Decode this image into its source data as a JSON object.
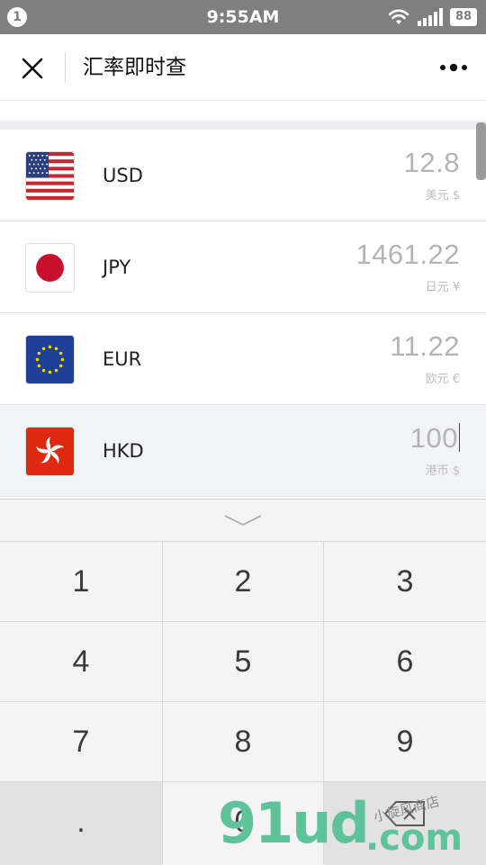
{
  "status_bar": {
    "notification_count": "1",
    "time": "9:55AM",
    "battery": "88"
  },
  "nav": {
    "title": "汇率即时查"
  },
  "currencies": [
    {
      "code": "USD",
      "amount": "12.8",
      "unit": "美元 $",
      "flag": "us-flag"
    },
    {
      "code": "JPY",
      "amount": "1461.22",
      "unit": "日元 ¥",
      "flag": "japan-flag"
    },
    {
      "code": "EUR",
      "amount": "11.22",
      "unit": "欧元 €",
      "flag": "eu-flag"
    },
    {
      "code": "HKD",
      "amount": "100",
      "unit": "港币 $",
      "flag": "hong-kong-flag",
      "active": true
    }
  ],
  "keypad": {
    "keys": [
      "1",
      "2",
      "3",
      "4",
      "5",
      "6",
      "7",
      "8",
      "9",
      ".",
      "0"
    ]
  },
  "watermark": {
    "brand": "91ud",
    "domain": ".com",
    "handwritten": "小旋风商店"
  }
}
